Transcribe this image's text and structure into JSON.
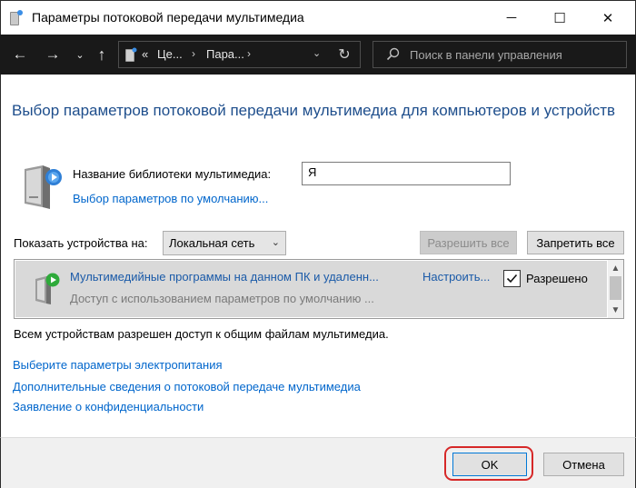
{
  "window": {
    "title": "Параметры потоковой передачи мультимедиа",
    "controls": {
      "minimize": "─",
      "maximize": "☐",
      "close": "✕"
    }
  },
  "addressbar": {
    "back": "←",
    "forward": "→",
    "recent": "⌄",
    "up": "↑",
    "overflow": "«",
    "crumbs": [
      "Це...",
      "Пара..."
    ],
    "separator": "›",
    "dropdown": "⌄",
    "refresh": "↻",
    "search_placeholder": "Поиск в панели управления"
  },
  "main": {
    "heading": "Выбор параметров потоковой передачи мультимедиа для компьютеров и устройств",
    "library_label": "Название библиотеки мультимедиа:",
    "library_value": "Я",
    "default_link": "Выбор параметров по умолчанию...",
    "show_devices_label": "Показать устройства на:",
    "show_devices_value": "Локальная сеть",
    "allow_all": "Разрешить все",
    "block_all": "Запретить все",
    "device": {
      "name": "Мультимедийные программы на данном ПК и удаленн...",
      "subtitle": "Доступ с использованием параметров по умолчанию ...",
      "configure": "Настроить...",
      "allowed_label": "Разрешено",
      "allowed": true
    },
    "status": "Всем устройствам разрешен доступ к общим файлам мультимедиа.",
    "links": [
      "Выберите параметры электропитания",
      "Дополнительные сведения о потоковой передаче мультимедиа",
      "Заявление о конфиденциальности"
    ]
  },
  "footer": {
    "ok": "OK",
    "cancel": "Отмена"
  },
  "colors": {
    "heading": "#1e4e8c",
    "link": "#0066cc",
    "highlight": "#d62828",
    "addressbar_bg": "#191919"
  },
  "icons": [
    "media-server-icon",
    "search-icon",
    "refresh-icon",
    "checkmark-icon",
    "media-device-icon"
  ]
}
